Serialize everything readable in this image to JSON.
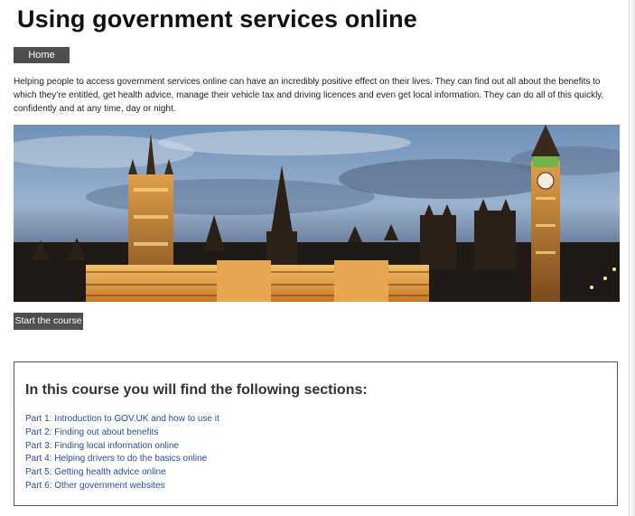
{
  "page": {
    "title": "Using government services online"
  },
  "nav": {
    "home_label": "Home"
  },
  "intro": {
    "text": "Helping people to access government services online can have an incredibly positive effect on their lives. They can find out all about the benefits to which they’re entitled, get health advice, manage their vehicle tax and driving licences and even get local information. They can do all of this quickly, confidently and at any time, day or night."
  },
  "banner": {
    "image_subject": "houses-of-parliament-dusk-photo"
  },
  "actions": {
    "start_label": "Start the course"
  },
  "sections": {
    "heading": "In this course you will find the following sections:",
    "links": [
      "Part 1: Introduction to GOV.UK and how to use it",
      "Part 2: Finding out about benefits",
      "Part 3: Finding local information online",
      "Part 4: Helping drivers to do the basics online",
      "Part 5: Getting health advice online",
      "Part 6: Other government websites"
    ]
  },
  "colors": {
    "button_bg": "#4f4f4f",
    "link": "#2a4c9c",
    "box_border": "#555555"
  }
}
